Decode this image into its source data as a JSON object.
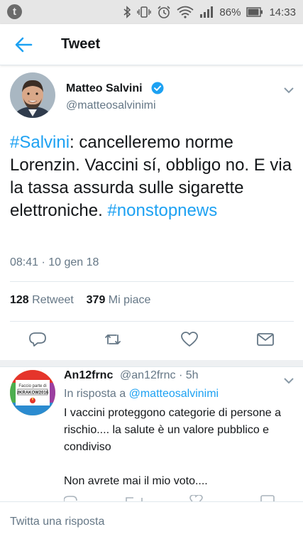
{
  "status_bar": {
    "app_icon": "t",
    "battery_percent": "86%",
    "time": "14:33",
    "icons": [
      "bluetooth-icon",
      "vibrate-icon",
      "alarm-icon",
      "wifi-icon",
      "signal-icon",
      "battery-icon"
    ]
  },
  "header": {
    "title": "Tweet",
    "back_icon": "back-arrow-icon"
  },
  "tweet": {
    "author_name": "Matteo Salvini",
    "author_handle": "@matteosalvinimi",
    "verified": true,
    "hashtag_1": "#Salvini",
    "text_after_hashtag": ": cancelleremo norme Lorenzin. Vaccini sí, obbligo no. E via la tassa assurda sulle sigarette elettroniche.",
    "hashtag_2": "#nonstopnews",
    "timestamp": "08:41 · 10 gen 18",
    "retweet_count": "128",
    "retweet_label": "Retweet",
    "like_count": "379",
    "like_label": "Mi piace",
    "actions": [
      "reply-icon",
      "retweet-icon",
      "heart-icon",
      "share-icon"
    ]
  },
  "reply": {
    "author_name": "An12frnc",
    "handle_and_time": "@an12frnc · 5h",
    "in_reply_prefix": "In risposta a ",
    "in_reply_handle": "@matteosalvinimi",
    "body": "I vaccini proteggono categorie di persone a rischio.... la salute è  un valore pubblico e condiviso\n\nNon avrete mai il mio voto....",
    "avatar_text_top": "Faccio parte di",
    "avatar_text_tag": "#KRAKOW2016"
  },
  "compose": {
    "placeholder": "Twitta una risposta"
  },
  "colors": {
    "accent": "#1da1f2",
    "muted": "#657786",
    "text": "#14171a",
    "verified": "#1da1f2"
  }
}
